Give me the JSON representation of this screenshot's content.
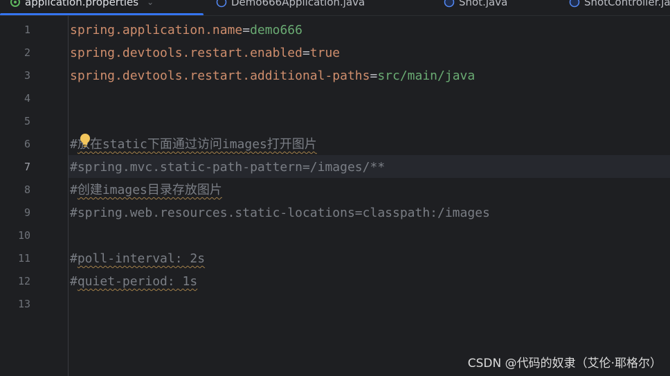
{
  "tabs": [
    {
      "label": "application.properties",
      "active": true,
      "icon": "properties-file-icon"
    },
    {
      "label": "Demo666Application.java",
      "active": false,
      "icon": "java-class-icon"
    },
    {
      "label": "Shot.java",
      "active": false,
      "icon": "java-class-icon"
    },
    {
      "label": "ShotController.java",
      "active": false,
      "icon": "java-class-icon"
    }
  ],
  "line_numbers": [
    "1",
    "2",
    "3",
    "4",
    "5",
    "6",
    "7",
    "8",
    "9",
    "10",
    "11",
    "12",
    "13"
  ],
  "current_line": "7",
  "code": {
    "l1": {
      "key": "spring.application.name",
      "eq": "=",
      "val": "demo666"
    },
    "l2": {
      "key": "spring.devtools.restart.enabled",
      "eq": "=",
      "val": "true"
    },
    "l3": {
      "key": "spring.devtools.restart.additional-paths",
      "eq": "=",
      "val": "src/main/java"
    },
    "l6": {
      "hash": "#",
      "text": "放在static下面通过访问images打开图片"
    },
    "l7": {
      "text": "#spring.mvc.static-path-pattern=/images/**"
    },
    "l8": {
      "hash": "#",
      "text": "创建images目录存放图片"
    },
    "l9": {
      "text": "#spring.web.resources.static-locations=classpath:/images"
    },
    "l11": {
      "hash": "#",
      "text": "poll-interval: 2s"
    },
    "l12": {
      "hash": "#",
      "text": "quiet-period: 1s"
    }
  },
  "colors": {
    "key": "#cf8e6d",
    "value": "#6aab73",
    "comment": "#7a7e85",
    "accent": "#3574f0",
    "background": "#1e1f22"
  },
  "intention_icon": "lightbulb-icon",
  "watermark": "CSDN @代码的奴隶（艾伦·耶格尔）"
}
